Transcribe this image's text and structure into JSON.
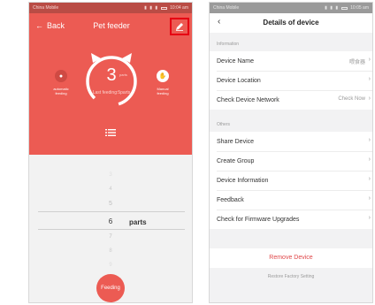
{
  "left_phone": {
    "statusbar": {
      "carrier": "China Mobile",
      "signal": "▮ ▮ ▮",
      "time": "10:04 am"
    },
    "header": {
      "back_label": "Back",
      "title": "Pet feeder"
    },
    "dial": {
      "count": "3",
      "unit": "parts",
      "caption": "Last feeding:5parts"
    },
    "auto_feeding": {
      "label": "automatic\nfeeding"
    },
    "manual_feeding": {
      "label": "Manual\nfeeding"
    },
    "picker": {
      "values_above": [
        "3",
        "4",
        "5"
      ],
      "selected_value": "6",
      "selected_unit": "parts",
      "values_below": [
        "7",
        "8",
        "9"
      ]
    },
    "feeding_button": "Feeding",
    "colors": {
      "accent": "#ec5b53",
      "highlight_box": "#e60012"
    }
  },
  "right_phone": {
    "statusbar": {
      "carrier": "China Mobile",
      "signal": "▮ ▮ ▮",
      "time": "10:05 am"
    },
    "header": {
      "back_icon": "‹",
      "title": "Details of device"
    },
    "information_section": {
      "label": "Information",
      "rows": [
        {
          "label": "Device Name",
          "value": "喂食器"
        },
        {
          "label": "Device Location",
          "value": ""
        },
        {
          "label": "Check Device Network",
          "value": "Check Now"
        }
      ]
    },
    "others_section": {
      "label": "Others",
      "rows": [
        {
          "label": "Share Device"
        },
        {
          "label": "Create Group"
        },
        {
          "label": "Device Information"
        },
        {
          "label": "Feedback"
        },
        {
          "label": "Check for Firmware Upgrades"
        }
      ]
    },
    "remove_device": "Remove Device",
    "restore_factory": "Restore Factory Setting",
    "colors": {
      "danger": "#e0484a"
    }
  }
}
